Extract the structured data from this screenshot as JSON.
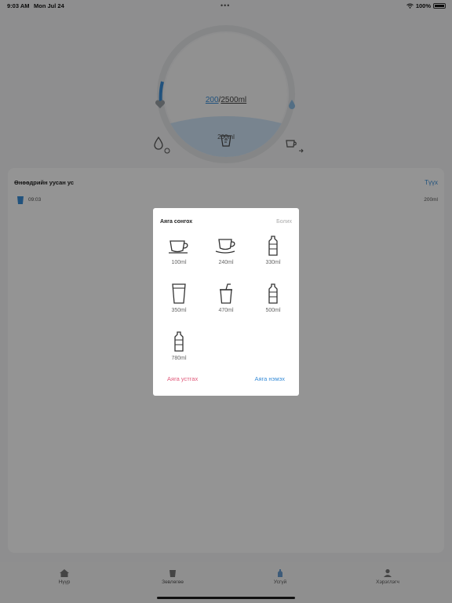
{
  "status_bar": {
    "time": "9:03 AM",
    "date": "Mon Jul 24",
    "battery": "100%"
  },
  "gauge": {
    "current": "200",
    "separator": "/",
    "target": "2500ml",
    "cup_amount": "200ml",
    "progress_fraction": 0.08
  },
  "today": {
    "title": "Өнөөдрийн уусан ус",
    "link": "Түүх",
    "entries": [
      {
        "time": "09:03",
        "amount": "200ml"
      }
    ]
  },
  "tabs": [
    {
      "label": "Нүүр"
    },
    {
      "label": "Зөвлөгөө"
    },
    {
      "label": "Усгүй"
    },
    {
      "label": "Хэрэглэгч"
    }
  ],
  "modal": {
    "title": "Аяга сонгох",
    "close_label": "Болих",
    "cups": [
      {
        "amount": "100ml",
        "icon": "coffee-cup-icon"
      },
      {
        "amount": "240ml",
        "icon": "mug-saucer-icon"
      },
      {
        "amount": "330ml",
        "icon": "bottle-icon"
      },
      {
        "amount": "350ml",
        "icon": "glass-icon"
      },
      {
        "amount": "470ml",
        "icon": "straw-cup-icon"
      },
      {
        "amount": "500ml",
        "icon": "bottle-icon"
      },
      {
        "amount": "780ml",
        "icon": "bottle-icon"
      }
    ],
    "remove_label": "Аяга устгах",
    "add_label": "Аяга нэмэх"
  },
  "colors": {
    "accent": "#3a8ed8",
    "danger": "#e05a7b",
    "overlay": "rgba(0,0,0,0.42)"
  }
}
